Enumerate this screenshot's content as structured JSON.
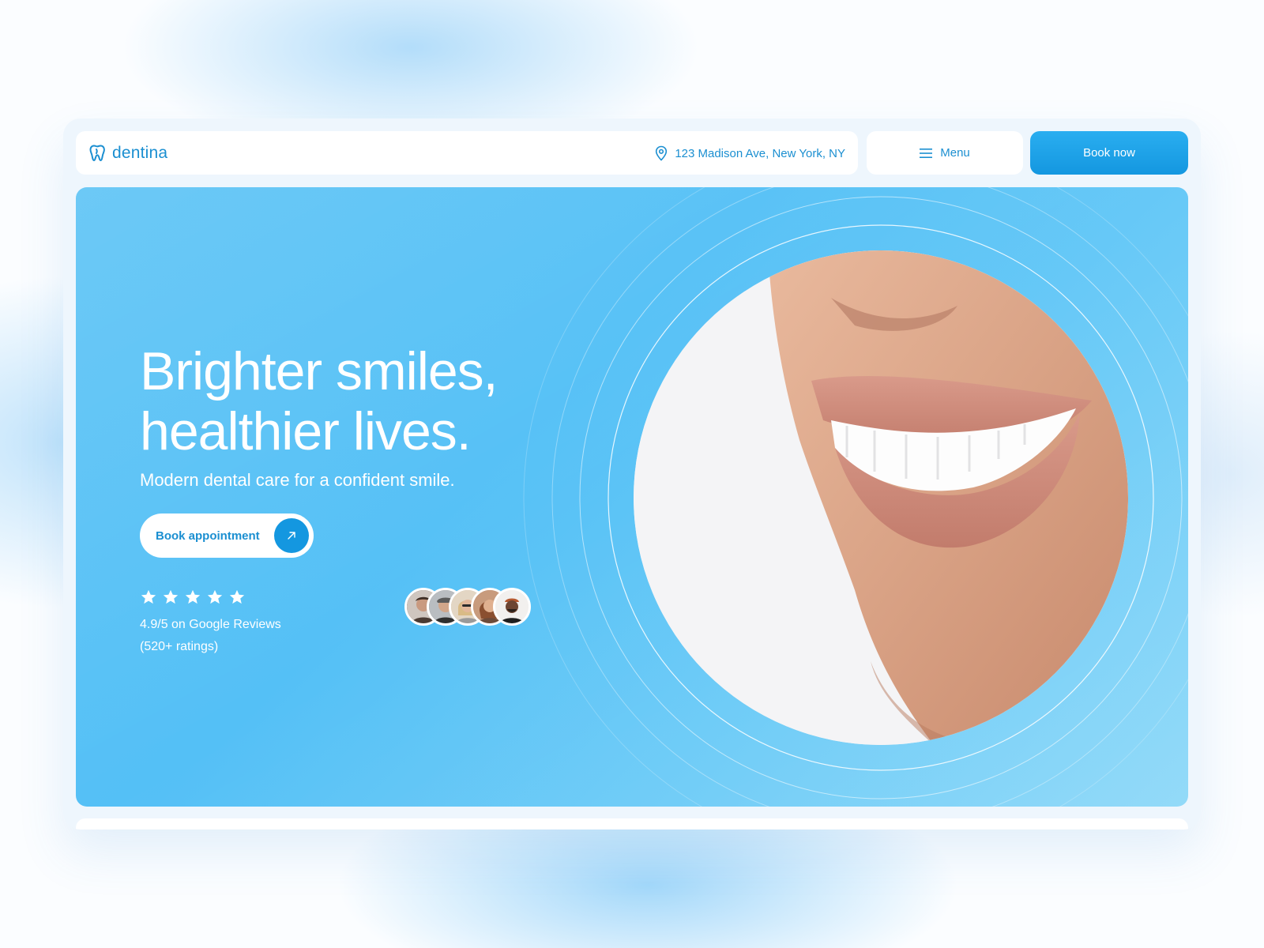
{
  "brand": {
    "name": "dentina",
    "logo_icon": "tooth-icon"
  },
  "header": {
    "address": "123 Madison Ave, New York, NY",
    "address_icon": "location-pin-icon",
    "menu_label": "Menu",
    "menu_icon": "hamburger-icon",
    "book_now_label": "Book now"
  },
  "hero": {
    "headline_line1": "Brighter smiles,",
    "headline_line2": "healthier lives.",
    "subheadline": "Modern dental care for a confident smile.",
    "cta_label": "Book appointment",
    "cta_icon": "arrow-up-right-icon",
    "rating": {
      "stars": 5,
      "text_line1": "4.9/5 on Google Reviews",
      "text_line2": "(520+ ratings)"
    },
    "avatars_count": 5,
    "photo_description_icon": "smile-photo"
  },
  "colors": {
    "accent": "#1497e0",
    "brand_text": "#1b8fd1",
    "hero_bg": "#5cc3f5",
    "white": "#ffffff"
  }
}
